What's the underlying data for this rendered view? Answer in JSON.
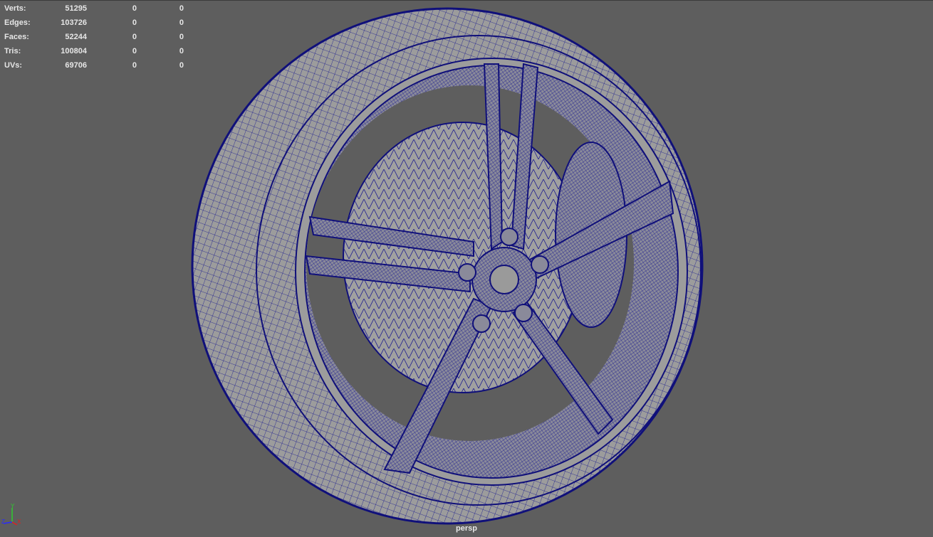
{
  "hud": {
    "rows": [
      {
        "label": "Verts:",
        "values": [
          "51295",
          "0",
          "0"
        ]
      },
      {
        "label": "Edges:",
        "values": [
          "103726",
          "0",
          "0"
        ]
      },
      {
        "label": "Faces:",
        "values": [
          "52244",
          "0",
          "0"
        ]
      },
      {
        "label": "Tris:",
        "values": [
          "100804",
          "0",
          "0"
        ]
      },
      {
        "label": "UVs:",
        "values": [
          "69706",
          "0",
          "0"
        ]
      }
    ]
  },
  "camera_label": "persp",
  "axis_labels": {
    "x": "X",
    "y": "Y",
    "z": "Z"
  },
  "colors": {
    "background": "#5e5e5e",
    "mesh_fill": "#9a9a9a",
    "wireframe": "#16168a",
    "hud_text": "#e6e6e6"
  }
}
